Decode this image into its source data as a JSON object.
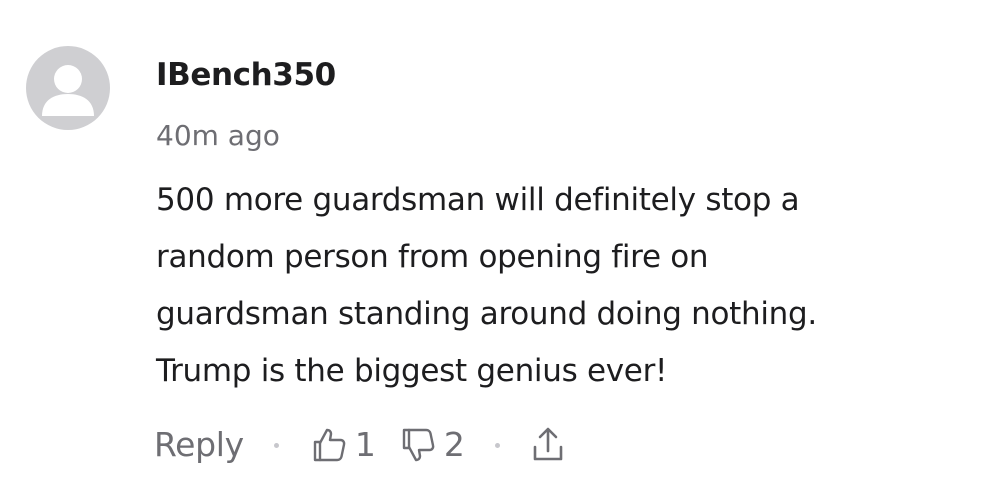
{
  "comment": {
    "avatar_icon": "default-user-avatar-icon",
    "username": "IBench350",
    "timestamp": "40m ago",
    "body_lines": [
      "500 more guardsman will definitely stop a",
      "random person from opening fire on",
      "guardsman standing around doing nothing.",
      "Trump is the biggest genius ever!"
    ],
    "actions": {
      "reply_label": "Reply",
      "upvote_icon": "thumbs-up-icon",
      "upvote_count": "1",
      "downvote_icon": "thumbs-down-icon",
      "downvote_count": "2",
      "share_icon": "share-icon"
    }
  },
  "colors": {
    "text_primary": "#1d1d1f",
    "text_secondary": "#6e6e73",
    "avatar_bg": "#cfcfd2",
    "separator": "#c7c7cc"
  }
}
